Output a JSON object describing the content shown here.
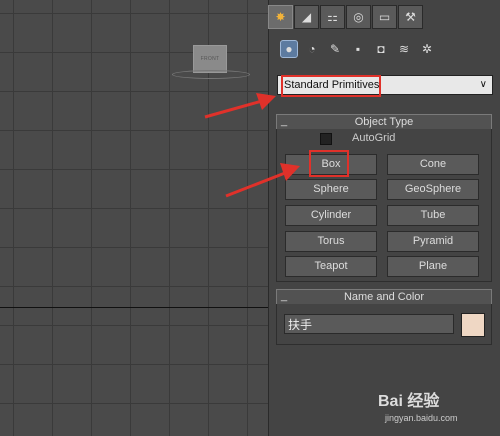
{
  "viewport": {
    "viewcube_label": "FRONT"
  },
  "command_panel": {
    "tabs": [
      {
        "name": "create-tab",
        "glyph": "✸",
        "active": true
      },
      {
        "name": "modify-tab",
        "glyph": "◢"
      },
      {
        "name": "hierarchy-tab",
        "glyph": "⚏"
      },
      {
        "name": "motion-tab",
        "glyph": "◎"
      },
      {
        "name": "display-tab",
        "glyph": "▭"
      },
      {
        "name": "utilities-tab",
        "glyph": "⚒"
      }
    ],
    "subcategories": [
      {
        "name": "geometry-icon",
        "glyph": "●",
        "active": true
      },
      {
        "name": "shapes-icon",
        "glyph": "◔"
      },
      {
        "name": "lights-icon",
        "glyph": "✎"
      },
      {
        "name": "cameras-icon",
        "glyph": "▪"
      },
      {
        "name": "helpers-icon",
        "glyph": "◘"
      },
      {
        "name": "spacewarps-icon",
        "glyph": "≋"
      },
      {
        "name": "systems-icon",
        "glyph": "✲"
      }
    ],
    "dropdown": {
      "value": "Standard Primitives",
      "arrow": "∨"
    },
    "object_type": {
      "title": "Object Type",
      "collapse_glyph": "_",
      "autogrid_label": "AutoGrid",
      "buttons": [
        "Box",
        "Cone",
        "Sphere",
        "GeoSphere",
        "Cylinder",
        "Tube",
        "Torus",
        "Pyramid",
        "Teapot",
        "Plane"
      ]
    },
    "name_and_color": {
      "title": "Name and Color",
      "collapse_glyph": "_",
      "name_value": "扶手",
      "color": "#efd7c4"
    }
  },
  "watermark": {
    "logo": "Bai 经验",
    "url": "jingyan.baidu.com"
  },
  "colors": {
    "highlight_red": "#e0312a"
  }
}
